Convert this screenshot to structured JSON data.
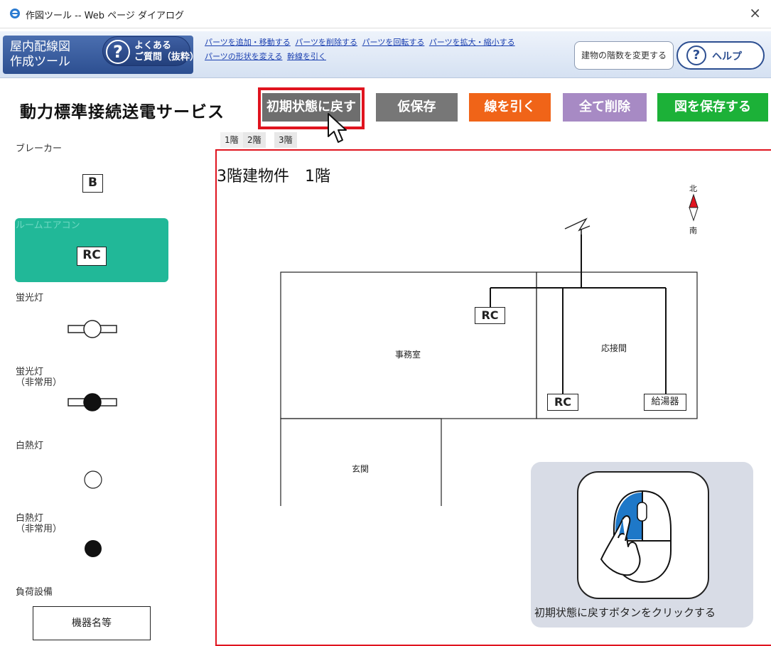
{
  "window": {
    "title": "作図ツール -- Web ページ ダイアログ",
    "close": "×"
  },
  "header": {
    "tool_title": "屋内配線図\n作成ツール",
    "faq_label": "よくある\nご質問（抜粋）",
    "links": [
      "パーツを追加・移動する",
      "パーツを削除する",
      "パーツを回転する",
      "パーツを拡大・縮小する",
      "パーツの形状を変える",
      "幹線を引く"
    ],
    "floor_change": "建物の階数を変更する",
    "help": "ヘルプ"
  },
  "service_title": "動力標準接続送電サービス",
  "actions": {
    "reset": "初期状態に戻す",
    "temp_save": "仮保存",
    "draw_line": "線を引く",
    "delete_all": "全て削除",
    "save": "図を保存する"
  },
  "palette": {
    "breaker_label": "ブレーカー",
    "breaker_symbol": "B",
    "room_ac_label": "ルームエアコン",
    "room_ac_symbol": "RC",
    "fluorescent_label": "蛍光灯",
    "fluorescent_emergency_label": "蛍光灯\n（非常用）",
    "incandescent_label": "白熱灯",
    "incandescent_emergency_label": "白熱灯\n（非常用）",
    "load_label": "負荷設備",
    "equipment_button": "機器名等"
  },
  "floor_tabs": [
    "1階",
    "2階",
    "3階"
  ],
  "canvas": {
    "title": "3階建物件　1階",
    "compass_north": "北",
    "compass_south": "南",
    "rooms": {
      "office": "事務室",
      "reception": "応接間",
      "entrance": "玄関"
    },
    "boxes": {
      "rc1": "RC",
      "rc2": "RC",
      "heater": "給湯器"
    }
  },
  "hint_text": "初期状態に戻すボタンをクリックする",
  "colors": {
    "accent_red": "#e0141f",
    "orange": "#f06418",
    "green": "#1cb138",
    "purple": "#a78ac4",
    "teal": "#21b898",
    "blue": "#2d4f91"
  }
}
